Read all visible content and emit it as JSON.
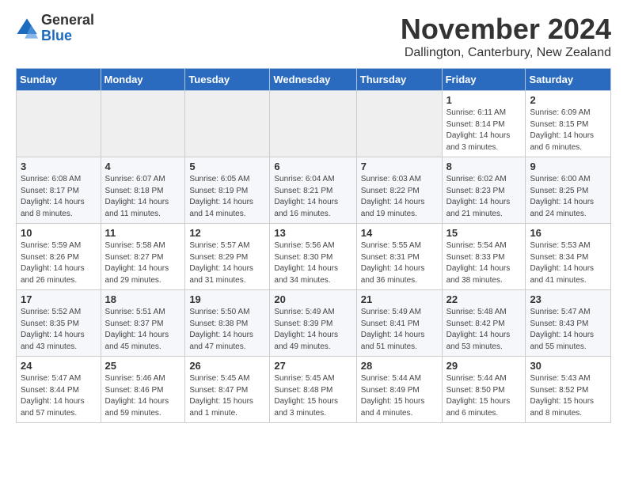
{
  "header": {
    "logo_general": "General",
    "logo_blue": "Blue",
    "month_title": "November 2024",
    "location": "Dallington, Canterbury, New Zealand"
  },
  "weekdays": [
    "Sunday",
    "Monday",
    "Tuesday",
    "Wednesday",
    "Thursday",
    "Friday",
    "Saturday"
  ],
  "weeks": [
    [
      {
        "day": "",
        "empty": true
      },
      {
        "day": "",
        "empty": true
      },
      {
        "day": "",
        "empty": true
      },
      {
        "day": "",
        "empty": true
      },
      {
        "day": "",
        "empty": true
      },
      {
        "day": "1",
        "sunrise": "Sunrise: 6:11 AM",
        "sunset": "Sunset: 8:14 PM",
        "daylight": "Daylight: 14 hours and 3 minutes."
      },
      {
        "day": "2",
        "sunrise": "Sunrise: 6:09 AM",
        "sunset": "Sunset: 8:15 PM",
        "daylight": "Daylight: 14 hours and 6 minutes."
      }
    ],
    [
      {
        "day": "3",
        "sunrise": "Sunrise: 6:08 AM",
        "sunset": "Sunset: 8:17 PM",
        "daylight": "Daylight: 14 hours and 8 minutes."
      },
      {
        "day": "4",
        "sunrise": "Sunrise: 6:07 AM",
        "sunset": "Sunset: 8:18 PM",
        "daylight": "Daylight: 14 hours and 11 minutes."
      },
      {
        "day": "5",
        "sunrise": "Sunrise: 6:05 AM",
        "sunset": "Sunset: 8:19 PM",
        "daylight": "Daylight: 14 hours and 14 minutes."
      },
      {
        "day": "6",
        "sunrise": "Sunrise: 6:04 AM",
        "sunset": "Sunset: 8:21 PM",
        "daylight": "Daylight: 14 hours and 16 minutes."
      },
      {
        "day": "7",
        "sunrise": "Sunrise: 6:03 AM",
        "sunset": "Sunset: 8:22 PM",
        "daylight": "Daylight: 14 hours and 19 minutes."
      },
      {
        "day": "8",
        "sunrise": "Sunrise: 6:02 AM",
        "sunset": "Sunset: 8:23 PM",
        "daylight": "Daylight: 14 hours and 21 minutes."
      },
      {
        "day": "9",
        "sunrise": "Sunrise: 6:00 AM",
        "sunset": "Sunset: 8:25 PM",
        "daylight": "Daylight: 14 hours and 24 minutes."
      }
    ],
    [
      {
        "day": "10",
        "sunrise": "Sunrise: 5:59 AM",
        "sunset": "Sunset: 8:26 PM",
        "daylight": "Daylight: 14 hours and 26 minutes."
      },
      {
        "day": "11",
        "sunrise": "Sunrise: 5:58 AM",
        "sunset": "Sunset: 8:27 PM",
        "daylight": "Daylight: 14 hours and 29 minutes."
      },
      {
        "day": "12",
        "sunrise": "Sunrise: 5:57 AM",
        "sunset": "Sunset: 8:29 PM",
        "daylight": "Daylight: 14 hours and 31 minutes."
      },
      {
        "day": "13",
        "sunrise": "Sunrise: 5:56 AM",
        "sunset": "Sunset: 8:30 PM",
        "daylight": "Daylight: 14 hours and 34 minutes."
      },
      {
        "day": "14",
        "sunrise": "Sunrise: 5:55 AM",
        "sunset": "Sunset: 8:31 PM",
        "daylight": "Daylight: 14 hours and 36 minutes."
      },
      {
        "day": "15",
        "sunrise": "Sunrise: 5:54 AM",
        "sunset": "Sunset: 8:33 PM",
        "daylight": "Daylight: 14 hours and 38 minutes."
      },
      {
        "day": "16",
        "sunrise": "Sunrise: 5:53 AM",
        "sunset": "Sunset: 8:34 PM",
        "daylight": "Daylight: 14 hours and 41 minutes."
      }
    ],
    [
      {
        "day": "17",
        "sunrise": "Sunrise: 5:52 AM",
        "sunset": "Sunset: 8:35 PM",
        "daylight": "Daylight: 14 hours and 43 minutes."
      },
      {
        "day": "18",
        "sunrise": "Sunrise: 5:51 AM",
        "sunset": "Sunset: 8:37 PM",
        "daylight": "Daylight: 14 hours and 45 minutes."
      },
      {
        "day": "19",
        "sunrise": "Sunrise: 5:50 AM",
        "sunset": "Sunset: 8:38 PM",
        "daylight": "Daylight: 14 hours and 47 minutes."
      },
      {
        "day": "20",
        "sunrise": "Sunrise: 5:49 AM",
        "sunset": "Sunset: 8:39 PM",
        "daylight": "Daylight: 14 hours and 49 minutes."
      },
      {
        "day": "21",
        "sunrise": "Sunrise: 5:49 AM",
        "sunset": "Sunset: 8:41 PM",
        "daylight": "Daylight: 14 hours and 51 minutes."
      },
      {
        "day": "22",
        "sunrise": "Sunrise: 5:48 AM",
        "sunset": "Sunset: 8:42 PM",
        "daylight": "Daylight: 14 hours and 53 minutes."
      },
      {
        "day": "23",
        "sunrise": "Sunrise: 5:47 AM",
        "sunset": "Sunset: 8:43 PM",
        "daylight": "Daylight: 14 hours and 55 minutes."
      }
    ],
    [
      {
        "day": "24",
        "sunrise": "Sunrise: 5:47 AM",
        "sunset": "Sunset: 8:44 PM",
        "daylight": "Daylight: 14 hours and 57 minutes."
      },
      {
        "day": "25",
        "sunrise": "Sunrise: 5:46 AM",
        "sunset": "Sunset: 8:46 PM",
        "daylight": "Daylight: 14 hours and 59 minutes."
      },
      {
        "day": "26",
        "sunrise": "Sunrise: 5:45 AM",
        "sunset": "Sunset: 8:47 PM",
        "daylight": "Daylight: 15 hours and 1 minute."
      },
      {
        "day": "27",
        "sunrise": "Sunrise: 5:45 AM",
        "sunset": "Sunset: 8:48 PM",
        "daylight": "Daylight: 15 hours and 3 minutes."
      },
      {
        "day": "28",
        "sunrise": "Sunrise: 5:44 AM",
        "sunset": "Sunset: 8:49 PM",
        "daylight": "Daylight: 15 hours and 4 minutes."
      },
      {
        "day": "29",
        "sunrise": "Sunrise: 5:44 AM",
        "sunset": "Sunset: 8:50 PM",
        "daylight": "Daylight: 15 hours and 6 minutes."
      },
      {
        "day": "30",
        "sunrise": "Sunrise: 5:43 AM",
        "sunset": "Sunset: 8:52 PM",
        "daylight": "Daylight: 15 hours and 8 minutes."
      }
    ]
  ]
}
